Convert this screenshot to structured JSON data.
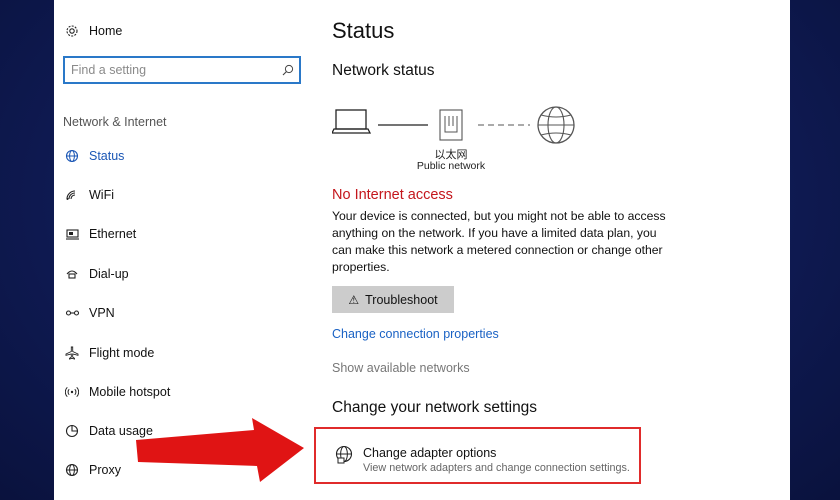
{
  "sidebar": {
    "home_label": "Home",
    "search_placeholder": "Find a setting",
    "section_label": "Network & Internet",
    "items": [
      {
        "label": "Status",
        "icon": "globe-icon",
        "active": true
      },
      {
        "label": "WiFi",
        "icon": "wifi-icon"
      },
      {
        "label": "Ethernet",
        "icon": "ethernet-icon"
      },
      {
        "label": "Dial-up",
        "icon": "dialup-icon"
      },
      {
        "label": "VPN",
        "icon": "vpn-icon"
      },
      {
        "label": "Flight mode",
        "icon": "airplane-icon"
      },
      {
        "label": "Mobile hotspot",
        "icon": "hotspot-icon"
      },
      {
        "label": "Data usage",
        "icon": "data-usage-icon"
      },
      {
        "label": "Proxy",
        "icon": "globe-icon"
      }
    ]
  },
  "main": {
    "title": "Status",
    "network_status_heading": "Network status",
    "adapter_name": "以太网",
    "network_type": "Public network",
    "error_title": "No Internet access",
    "error_description": "Your device is connected, but you might not be able to access anything on the network. If you have a limited data plan, you can make this network a metered connection or change other properties.",
    "troubleshoot_label": "Troubleshoot",
    "change_connection_label": "Change connection properties",
    "show_networks_label": "Show available networks",
    "change_settings_heading": "Change your network settings",
    "adapter_option_title": "Change adapter options",
    "adapter_option_subtitle": "View network adapters and change connection settings."
  },
  "colors": {
    "accent": "#1a56b5",
    "error": "#c4161c",
    "highlight_border": "#e02b2b",
    "arrow": "#e01414",
    "background": "#0f1b55"
  }
}
